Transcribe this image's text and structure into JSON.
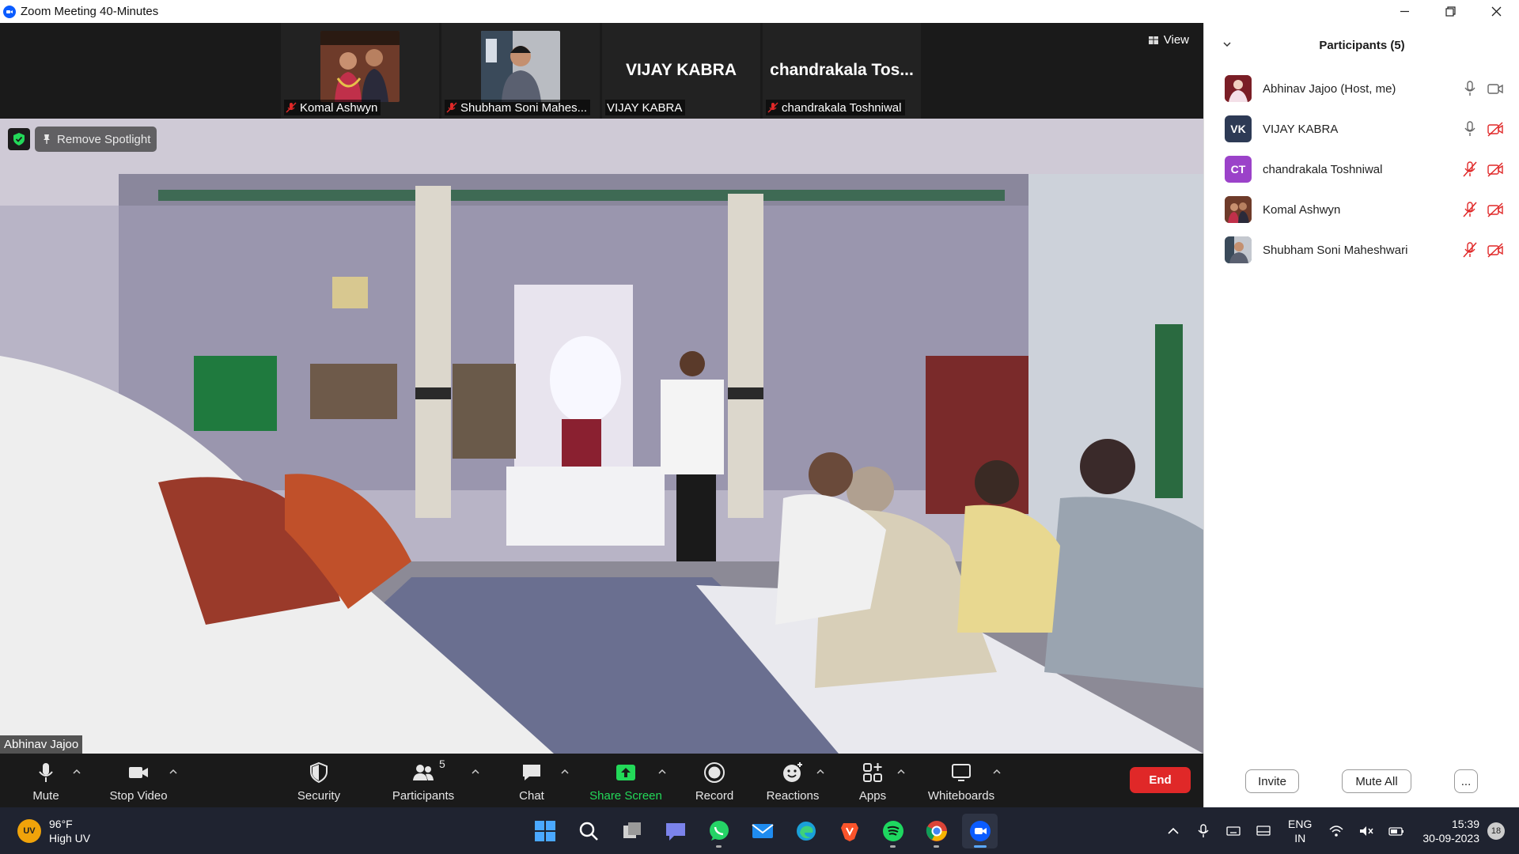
{
  "window": {
    "title": "Zoom Meeting 40-Minutes"
  },
  "gallery": {
    "view_label": "View",
    "tiles": [
      {
        "name": "Komal Ashwyn",
        "muted": true,
        "has_video_image": true
      },
      {
        "name": "Shubham Soni Mahes...",
        "muted": true,
        "has_video_image": true
      },
      {
        "name": "VIJAY KABRA",
        "big_name": "VIJAY KABRA",
        "muted": false
      },
      {
        "name": "chandrakala Toshniwal",
        "big_name": "chandrakala  Tos...",
        "muted": true
      }
    ]
  },
  "main_video": {
    "remove_spotlight_label": "Remove Spotlight",
    "speaker_name": "Abhinav Jajoo"
  },
  "toolbar": {
    "mute": "Mute",
    "stop_video": "Stop Video",
    "security": "Security",
    "participants": "Participants",
    "participants_count": "5",
    "chat": "Chat",
    "share_screen": "Share Screen",
    "record": "Record",
    "reactions": "Reactions",
    "apps": "Apps",
    "whiteboards": "Whiteboards",
    "end": "End"
  },
  "participants_panel": {
    "title": "Participants (5)",
    "list": [
      {
        "name": "Abhinav Jajoo (Host, me)",
        "initials": "",
        "avatar_color": "#b23a3a",
        "mic": "on",
        "video": "on"
      },
      {
        "name": "VIJAY KABRA",
        "initials": "VK",
        "avatar_color": "#2d3a55",
        "mic": "on",
        "video": "off"
      },
      {
        "name": "chandrakala Toshniwal",
        "initials": "CT",
        "avatar_color": "#9b42c9",
        "mic": "off",
        "video": "off"
      },
      {
        "name": "Komal Ashwyn",
        "initials": "",
        "avatar_color": "#8a5a3a",
        "mic": "off",
        "video": "off"
      },
      {
        "name": "Shubham Soni Maheshwari",
        "initials": "",
        "avatar_color": "#5a6a80",
        "mic": "off",
        "video": "off"
      }
    ],
    "invite": "Invite",
    "mute_all": "Mute All",
    "more": "..."
  },
  "taskbar": {
    "weather_temp": "96°F",
    "weather_desc": "High UV",
    "weather_badge": "UV",
    "lang_line1": "ENG",
    "lang_line2": "IN",
    "time": "15:39",
    "date": "30-09-2023",
    "notifications": "18"
  },
  "colors": {
    "accent_blue": "#0b5cff",
    "end_red": "#e02828",
    "share_green": "#23d959",
    "muted_red": "#e02828"
  }
}
